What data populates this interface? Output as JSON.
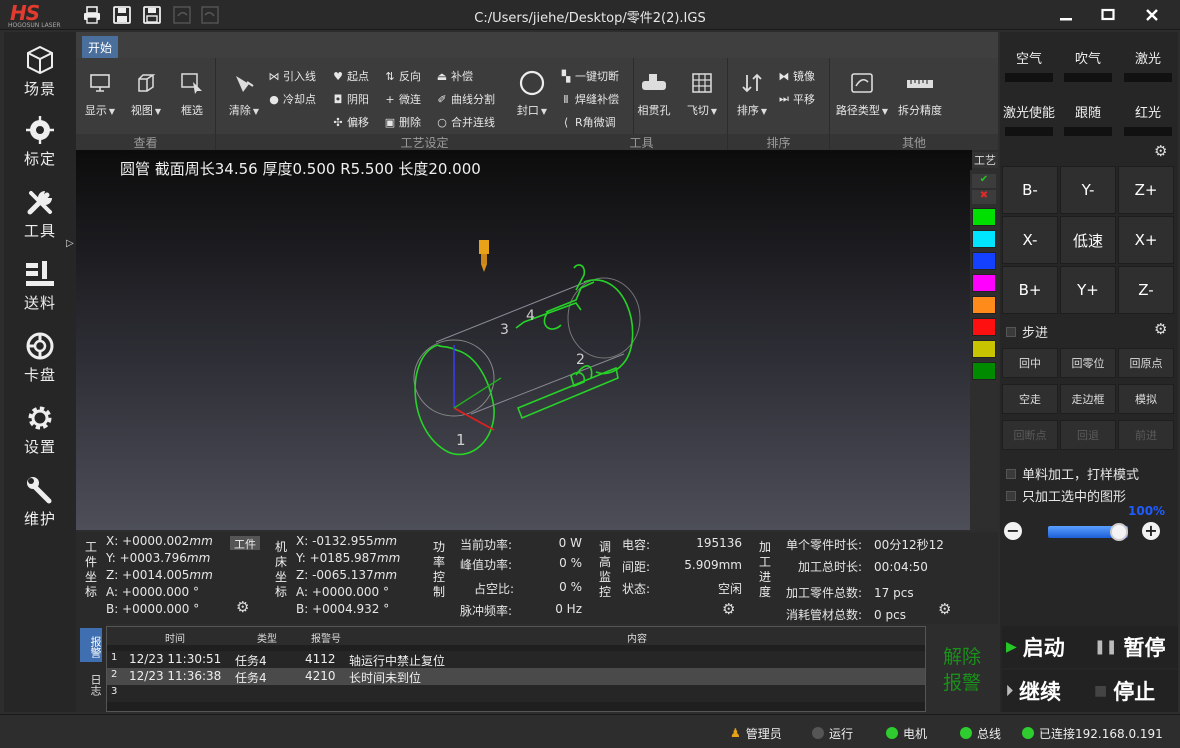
{
  "app": {
    "title": "C:/Users/jiehe/Desktop/零件2(2).IGS",
    "logo_text": "HS",
    "logo_sub": "HOGOSUN LASER"
  },
  "nav": {
    "items": [
      {
        "label": "场景"
      },
      {
        "label": "标定"
      },
      {
        "label": "工具"
      },
      {
        "label": "送料"
      },
      {
        "label": "卡盘"
      },
      {
        "label": "设置"
      },
      {
        "label": "维护"
      }
    ]
  },
  "ribbon": {
    "tab": "开始",
    "groups": {
      "view": {
        "label": "查看",
        "display": "显示",
        "viewmenu": "视图",
        "select": "框选"
      },
      "process": {
        "label": "工艺设定",
        "clear": "清除",
        "lead_in": "引入线",
        "start_point": "起点",
        "reverse": "反向",
        "compensate": "补偿",
        "cool_point": "冷却点",
        "yin_yang": "阴阳",
        "micro_joint": "微连",
        "curve_split": "曲线分割",
        "offset": "偏移",
        "delete": "删除",
        "merge_lines": "合并连线",
        "seal": "封口"
      },
      "tools": {
        "label": "工具",
        "one_key_cut": "一键切断",
        "weld_comp": "焊缝补偿",
        "r_corner": "R角微调",
        "through_hole": "相贯孔",
        "fly_cut": "飞切"
      },
      "sort": {
        "label": "排序",
        "sort": "排序",
        "mirror": "镜像",
        "translate": "平移"
      },
      "other": {
        "label": "其他",
        "path_type": "路径类型",
        "split_precision": "拆分精度"
      }
    }
  },
  "viewport": {
    "part_info": "圆管 截面周长34.56 厚度0.500 R5.500 长度20.000",
    "palette_label": "工艺",
    "palette_colors": [
      "#00e000",
      "#00e5ff",
      "#1440ff",
      "#ff00ff",
      "#ff8c1a",
      "#ff1010",
      "#c8c400",
      "#008a00"
    ],
    "labels": {
      "l1": "1",
      "l2": "2",
      "l3": "3",
      "l4": "4"
    }
  },
  "right": {
    "toggles": [
      {
        "label": "空气"
      },
      {
        "label": "吹气"
      },
      {
        "label": "激光"
      },
      {
        "label": "激光使能"
      },
      {
        "label": "跟随"
      },
      {
        "label": "红光"
      }
    ],
    "jog": [
      "B-",
      "Y-",
      "Z+",
      "X-",
      "低速",
      "X+",
      "B+",
      "Y+",
      "Z-"
    ],
    "step_label": "步进",
    "controls": [
      "回中",
      "回零位",
      "回原点",
      "空走",
      "走边框",
      "模拟",
      "回断点",
      "回退",
      "前进"
    ],
    "single_mode": "单料加工，打样模式",
    "only_selected": "只加工选中的图形",
    "speed_percent": "100%",
    "speed_value": 1.0
  },
  "status": {
    "workpiece_label": "工件坐标",
    "workpiece_btn": "工件",
    "work_coords": [
      {
        "axis": "X:",
        "value": "+0000.002",
        "unit": "mm"
      },
      {
        "axis": "Y:",
        "value": "+0003.796",
        "unit": "mm"
      },
      {
        "axis": "Z:",
        "value": "+0014.005",
        "unit": "mm"
      },
      {
        "axis": "A:",
        "value": "+0000.000",
        "unit": "°"
      },
      {
        "axis": "B:",
        "value": "+0000.000",
        "unit": "°"
      }
    ],
    "machine_label": "机床坐标",
    "machine_coords": [
      {
        "axis": "X:",
        "value": "-0132.955",
        "unit": "mm"
      },
      {
        "axis": "Y:",
        "value": "+0185.987",
        "unit": "mm"
      },
      {
        "axis": "Z:",
        "value": "-0065.137",
        "unit": "mm"
      },
      {
        "axis": "A:",
        "value": "+0000.000",
        "unit": "°"
      },
      {
        "axis": "B:",
        "value": "+0004.932",
        "unit": "°"
      }
    ],
    "power_label": "功率控制",
    "power": [
      {
        "k": "当前功率:",
        "v": "0 W"
      },
      {
        "k": "峰值功率:",
        "v": "0 %"
      },
      {
        "k": "占空比:",
        "v": "0 %"
      },
      {
        "k": "脉冲频率:",
        "v": "0 Hz"
      }
    ],
    "height_label": "调高监控",
    "height": [
      {
        "k": "电容:",
        "v": "195136"
      },
      {
        "k": "间距:",
        "v": "5.909mm"
      },
      {
        "k": "状态:",
        "v": "空闲"
      }
    ],
    "progress_label": "加工进度",
    "progress": [
      {
        "k": "单个零件时长:",
        "v": "00分12秒12"
      },
      {
        "k": "加工总时长:",
        "v": "00:04:50"
      },
      {
        "k": "加工零件总数:",
        "v": "17 pcs"
      },
      {
        "k": "消耗管材总数:",
        "v": "0 pcs"
      }
    ]
  },
  "log": {
    "side_tabs": [
      "报警",
      "日志"
    ],
    "headers": {
      "time": "时间",
      "type": "类型",
      "code": "报警号",
      "content": "内容"
    },
    "rows": [
      {
        "n": "1",
        "time": "12/23 11:30:51",
        "type": "任务4",
        "code": "4112",
        "content": "轴运行中禁止复位"
      },
      {
        "n": "2",
        "time": "12/23 11:36:38",
        "type": "任务4",
        "code": "4210",
        "content": "长时间未到位"
      },
      {
        "n": "3",
        "time": "",
        "type": "",
        "code": "",
        "content": ""
      }
    ],
    "clear_alarm": [
      "解除",
      "报警"
    ]
  },
  "bigctrl": {
    "start": "启动",
    "pause": "暂停",
    "resume": "继续",
    "stop": "停止"
  },
  "statusbar": {
    "admin": "管理员",
    "run": "运行",
    "motor": "电机",
    "bus": "总线",
    "connected": "已连接192.168.0.191"
  }
}
